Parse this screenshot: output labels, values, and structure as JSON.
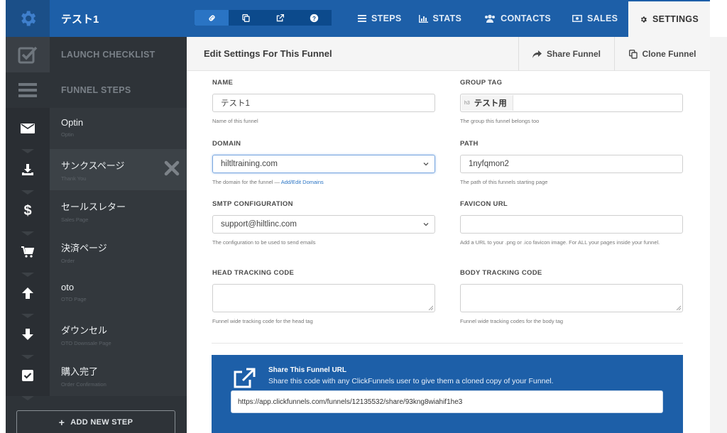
{
  "header": {
    "funnel_title": "テスト1",
    "nav": [
      {
        "label": "STEPS",
        "icon": "list-icon"
      },
      {
        "label": "STATS",
        "icon": "bar-chart-icon"
      },
      {
        "label": "CONTACTS",
        "icon": "users-icon"
      },
      {
        "label": "SALES",
        "icon": "money-icon"
      },
      {
        "label": "SETTINGS",
        "icon": "gear-icon"
      }
    ],
    "icon_group": [
      "link-icon",
      "copy-icon",
      "external-link-icon",
      "help-icon"
    ],
    "brand_color": "#1d5fa8"
  },
  "sidebar": {
    "launch_checklist": "LAUNCH CHECKLIST",
    "funnel_steps": "FUNNEL STEPS",
    "steps": [
      {
        "name": "Optin",
        "type": "Optin",
        "icon": "envelope-icon"
      },
      {
        "name": "サンクスページ",
        "type": "Thank You",
        "icon": "download-icon"
      },
      {
        "name": "セールスレター",
        "type": "Sales Page",
        "icon": "dollar-icon"
      },
      {
        "name": "決済ページ",
        "type": "Order",
        "icon": "cart-icon"
      },
      {
        "name": "oto",
        "type": "OTO Page",
        "icon": "arrow-up-icon"
      },
      {
        "name": "ダウンセル",
        "type": "OTO Downsale Page",
        "icon": "arrow-down-icon"
      },
      {
        "name": "購入完了",
        "type": "Order Confirmation",
        "icon": "check-square-icon"
      }
    ],
    "add_step": "ADD NEW STEP"
  },
  "content_header": {
    "title": "Edit Settings For This Funnel",
    "share_funnel": "Share Funnel",
    "clone_funnel": "Clone Funnel"
  },
  "form": {
    "name": {
      "label": "NAME",
      "value": "テスト1",
      "help": "Name of this funnel"
    },
    "group_tag": {
      "label": "GROUP TAG",
      "tag_prefix": "h3",
      "value": "テスト用",
      "help": "The group this funnel belongs too"
    },
    "domain": {
      "label": "DOMAIN",
      "value": "hiltltraining.com",
      "help": "The domain for the funnel —",
      "help_link": "Add/Edit Domains"
    },
    "path": {
      "label": "PATH",
      "value": "1nyfqmon2",
      "help": "The path of this funnels starting page"
    },
    "smtp": {
      "label": "SMTP CONFIGURATION",
      "value": "support@hiltlinc.com",
      "help": "The configuration to be used to send emails"
    },
    "favicon": {
      "label": "FAVICON URL",
      "value": "",
      "help": "Add a URL to your .png or .ico favicon image. For ALL your pages inside your funnel."
    },
    "head_tracking": {
      "label": "HEAD TRACKING CODE",
      "value": "",
      "help": "Funnel wide tracking code for the head tag"
    },
    "body_tracking": {
      "label": "BODY TRACKING CODE",
      "value": "",
      "help": "Funnel wide tracking codes for the body tag"
    }
  },
  "share": {
    "title": "Share This Funnel URL",
    "subtitle": "Share this code with any ClickFunnels user to give them a cloned copy of your Funnel.",
    "url": "https://app.clickfunnels.com/funnels/12135532/share/93kng8wiahif1he3"
  }
}
